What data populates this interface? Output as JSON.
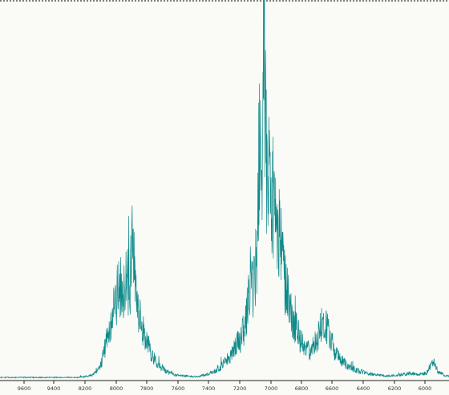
{
  "chart_data": {
    "type": "line",
    "x_axis": {
      "ticks": [
        9600,
        9400,
        8200,
        8000,
        7800,
        7600,
        7400,
        7200,
        7000,
        6800,
        6600,
        6400,
        6200,
        6000
      ],
      "tick_labels": [
        "9600",
        "9400",
        "8200",
        "8000",
        "7800",
        "7600",
        "7400",
        "7200",
        "7000",
        "6800",
        "6600",
        "6400",
        "6200",
        "6000"
      ]
    },
    "series": [
      {
        "color": "#0e8a8a",
        "points": [
          [
            0,
            0.004
          ],
          [
            0.17,
            0.004
          ],
          [
            0.19,
            0.006
          ],
          [
            0.205,
            0.01
          ],
          [
            0.215,
            0.02
          ],
          [
            0.225,
            0.04
          ],
          [
            0.235,
            0.09
          ],
          [
            0.242,
            0.12
          ],
          [
            0.25,
            0.17
          ],
          [
            0.258,
            0.21
          ],
          [
            0.266,
            0.25
          ],
          [
            0.274,
            0.23
          ],
          [
            0.281,
            0.27
          ],
          [
            0.289,
            0.24
          ],
          [
            0.296,
            0.38
          ],
          [
            0.3,
            0.25
          ],
          [
            0.306,
            0.18
          ],
          [
            0.315,
            0.15
          ],
          [
            0.325,
            0.1
          ],
          [
            0.335,
            0.07
          ],
          [
            0.35,
            0.04
          ],
          [
            0.37,
            0.02
          ],
          [
            0.39,
            0.01
          ],
          [
            0.41,
            0.008
          ],
          [
            0.44,
            0.006
          ],
          [
            0.46,
            0.012
          ],
          [
            0.475,
            0.02
          ],
          [
            0.49,
            0.03
          ],
          [
            0.505,
            0.05
          ],
          [
            0.515,
            0.06
          ],
          [
            0.525,
            0.09
          ],
          [
            0.535,
            0.1
          ],
          [
            0.545,
            0.14
          ],
          [
            0.552,
            0.19
          ],
          [
            0.558,
            0.28
          ],
          [
            0.565,
            0.24
          ],
          [
            0.572,
            0.33
          ],
          [
            0.578,
            0.68
          ],
          [
            0.584,
            0.54
          ],
          [
            0.588,
            1.0
          ],
          [
            0.592,
            0.58
          ],
          [
            0.598,
            0.55
          ],
          [
            0.605,
            0.5
          ],
          [
            0.612,
            0.46
          ],
          [
            0.62,
            0.4
          ],
          [
            0.63,
            0.3
          ],
          [
            0.64,
            0.22
          ],
          [
            0.65,
            0.16
          ],
          [
            0.66,
            0.13
          ],
          [
            0.67,
            0.1
          ],
          [
            0.68,
            0.08
          ],
          [
            0.69,
            0.07
          ],
          [
            0.7,
            0.09
          ],
          [
            0.71,
            0.12
          ],
          [
            0.718,
            0.15
          ],
          [
            0.726,
            0.14
          ],
          [
            0.735,
            0.12
          ],
          [
            0.745,
            0.07
          ],
          [
            0.76,
            0.05
          ],
          [
            0.78,
            0.03
          ],
          [
            0.8,
            0.02
          ],
          [
            0.83,
            0.012
          ],
          [
            0.86,
            0.008
          ],
          [
            0.89,
            0.01
          ],
          [
            0.91,
            0.014
          ],
          [
            0.93,
            0.012
          ],
          [
            0.95,
            0.016
          ],
          [
            0.965,
            0.05
          ],
          [
            0.975,
            0.02
          ],
          [
            0.99,
            0.01
          ],
          [
            1.0,
            0.008
          ]
        ]
      }
    ],
    "grid": false,
    "legend": "none"
  }
}
